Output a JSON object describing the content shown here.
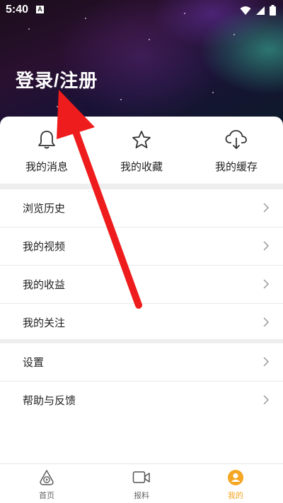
{
  "status_bar": {
    "time": "5:40",
    "notification_badge": "A",
    "icons": [
      "wifi-icon",
      "signal-icon",
      "battery-icon"
    ]
  },
  "header": {
    "login_label": "登录/注册"
  },
  "quick_actions": [
    {
      "label": "我的消息",
      "icon": "bell-icon"
    },
    {
      "label": "我的收藏",
      "icon": "star-icon"
    },
    {
      "label": "我的缓存",
      "icon": "cloud-download-icon"
    }
  ],
  "menu_group_1": [
    {
      "label": "浏览历史"
    },
    {
      "label": "我的视频"
    },
    {
      "label": "我的收益"
    },
    {
      "label": "我的关注"
    }
  ],
  "menu_group_2": [
    {
      "label": "设置"
    },
    {
      "label": "帮助与反馈"
    }
  ],
  "tabbar": {
    "tabs": [
      {
        "label": "首页",
        "icon": "play-home-icon"
      },
      {
        "label": "报料",
        "icon": "video-camera-icon"
      },
      {
        "label": "我的",
        "icon": "user-profile-icon"
      }
    ],
    "active_index": 2,
    "active_color": "#f5a623"
  },
  "annotation": {
    "arrow_color": "#ee1c1c"
  }
}
